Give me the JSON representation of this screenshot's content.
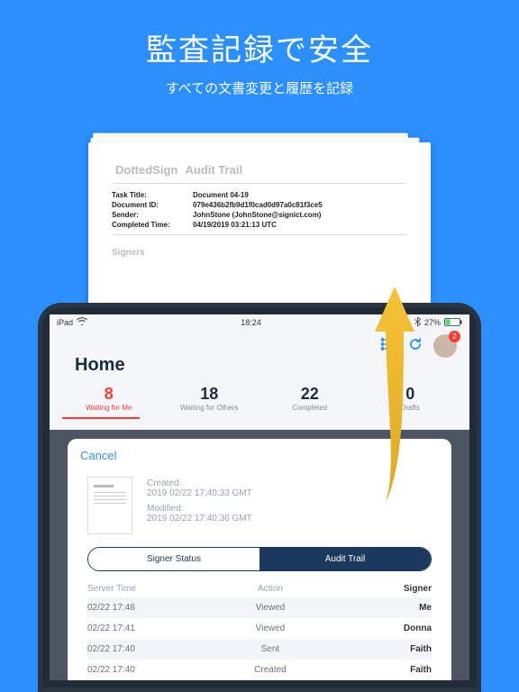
{
  "hero": {
    "title": "監査記録で安全",
    "subtitle": "すべての文書変更と履歴を記録"
  },
  "document": {
    "brand": "DottedSign",
    "brand_sub": "Audit Trail",
    "fields": {
      "task_label": "Task Title:",
      "task_value": "Document 04-19",
      "docid_label": "Document ID:",
      "docid_value": "079e436b2fb9d1f0cad0d97a0c81f3ce5",
      "sender_label": "Sender:",
      "sender_value": "JohnStone  (JohnStone@signict.com)",
      "completed_label": "Completed Time:",
      "completed_value": "04/19/2019 03:21:13 UTC"
    },
    "signers_heading": "Signers"
  },
  "status": {
    "device": "iPad",
    "time": "18:24",
    "battery": "27%"
  },
  "header": {
    "title": "Home",
    "notif_count": "2"
  },
  "stats": [
    {
      "num": "8",
      "label": "Waiting for Me",
      "red": true
    },
    {
      "num": "18",
      "label": "Waiting for Others"
    },
    {
      "num": "22",
      "label": "Completed"
    },
    {
      "num": "0",
      "label": "Drafts"
    }
  ],
  "modal": {
    "cancel": "Cancel",
    "created_label": "Created:",
    "created_value": "2019 02/22 17:40:33 GMT",
    "modified_label": "Modified:",
    "modified_value": "2019 02/22 17:40:36 GMT",
    "seg_left": "Signer Status",
    "seg_right": "Audit Trail",
    "thead": {
      "c1": "Server Time",
      "c2": "Action",
      "c3": "Signer"
    },
    "rows": [
      {
        "c1": "02/22 17:48",
        "c2": "Viewed",
        "c3": "Me"
      },
      {
        "c1": "02/22 17:41",
        "c2": "Viewed",
        "c3": "Donna"
      },
      {
        "c1": "02/22 17:40",
        "c2": "Sent",
        "c3": "Faith"
      },
      {
        "c1": "02/22 17:40",
        "c2": "Created",
        "c3": "Faith"
      }
    ]
  }
}
